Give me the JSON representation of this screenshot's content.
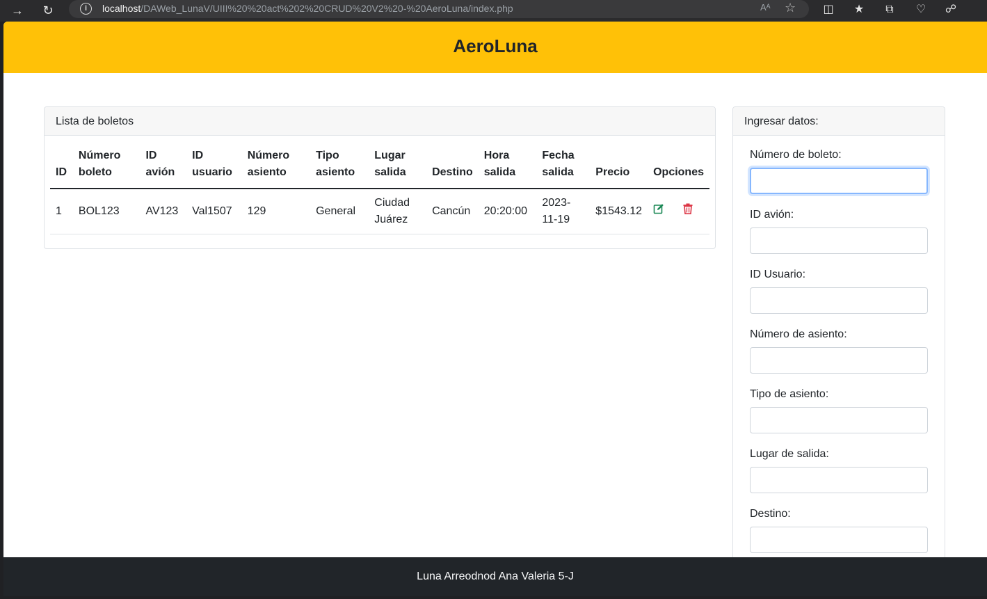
{
  "browser": {
    "url_host": "localhost",
    "url_path": "/DAWeb_LunaV/UIII%20%20act%202%20CRUD%20V2%20-%20AeroLuna/index.php",
    "read_aloud_label": "Aᴬ"
  },
  "header": {
    "title": "AeroLuna"
  },
  "list": {
    "title": "Lista de boletos",
    "columns": [
      "ID",
      "Número boleto",
      "ID avión",
      "ID usuario",
      "Número asiento",
      "Tipo asiento",
      "Lugar salida",
      "Destino",
      "Hora salida",
      "Fecha salida",
      "Precio",
      "Opciones"
    ],
    "rows": [
      {
        "id": "1",
        "numero_boleto": "BOL123",
        "id_avion": "AV123",
        "id_usuario": "Val1507",
        "numero_asiento": "129",
        "tipo_asiento": "General",
        "lugar_salida": "Ciudad Juárez",
        "destino": "Cancún",
        "hora_salida": "20:20:00",
        "fecha_salida": "2023-11-19",
        "precio": "$1543.12"
      }
    ]
  },
  "form": {
    "title": "Ingresar datos:",
    "fields": [
      {
        "label": "Número de boleto:",
        "value": ""
      },
      {
        "label": "ID avión:",
        "value": ""
      },
      {
        "label": "ID Usuario:",
        "value": ""
      },
      {
        "label": "Número de asiento:",
        "value": ""
      },
      {
        "label": "Tipo de asiento:",
        "value": ""
      },
      {
        "label": "Lugar de salida:",
        "value": ""
      },
      {
        "label": "Destino:",
        "value": ""
      }
    ]
  },
  "footer": {
    "text": "Luna Arreodnod Ana Valeria 5-J"
  },
  "colors": {
    "header_bg": "#ffc107",
    "footer_bg": "#212529",
    "edit": "#198754",
    "delete": "#dc3545"
  }
}
